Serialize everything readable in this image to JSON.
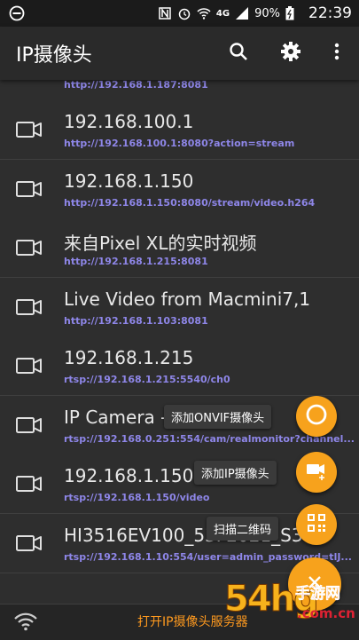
{
  "status_bar": {
    "network": "4G",
    "battery": "90%",
    "time": "22:39"
  },
  "app_bar": {
    "title": "IP摄像头",
    "search_icon": "search-icon",
    "settings_icon": "gear-icon",
    "more_icon": "more-vert-icon"
  },
  "list": {
    "partial_url": "http://192.168.1.187:8081",
    "items": [
      {
        "name": "192.168.100.1",
        "url": "http://192.168.100.1:8080?action=stream"
      },
      {
        "name": "192.168.1.150",
        "url": "http://192.168.1.150:8080/stream/video.h264"
      },
      {
        "name": "来自Pixel XL的实时视频",
        "url": "http://192.168.1.215:8081"
      },
      {
        "name": "Live Video from Macmini7,1",
        "url": "http://192.168.1.103:8081"
      },
      {
        "name": "192.168.1.215",
        "url": "rtsp://192.168.1.215:5540/ch0"
      },
      {
        "name": "IP Camera -",
        "url": "rtsp://192.168.0.251:554/cam/realmonitor?channel..."
      },
      {
        "name": "192.168.1.150",
        "url": "rtsp://192.168.1.150/video"
      },
      {
        "name": "HI3516EV100_53F2021_S3",
        "url": "rtsp://192.168.1.10:554/user=admin_password=tlJ..."
      }
    ]
  },
  "fab_menu": {
    "onvif_label": "添加ONVIF摄像头",
    "ip_label": "添加IP摄像头",
    "qr_label": "扫描二维码",
    "main_icon": "close-icon"
  },
  "bottom_bar": {
    "label": "打开IP摄像头服务器"
  },
  "watermark": {
    "big": "54hg",
    "small": "手游网",
    "domain": ".com.cn"
  },
  "colors": {
    "accent": "#f7a21c",
    "url": "#8e86e8",
    "background": "#2e2e2e"
  }
}
